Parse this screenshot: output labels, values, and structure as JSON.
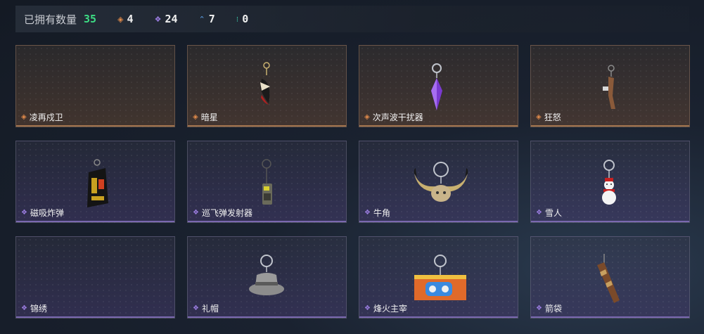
{
  "header": {
    "title": "已拥有数量",
    "total": "35",
    "stats": [
      {
        "name": "orange",
        "value": "4"
      },
      {
        "name": "purple",
        "value": "24"
      },
      {
        "name": "blue",
        "value": "7"
      },
      {
        "name": "teal",
        "value": "0"
      }
    ]
  },
  "items": [
    {
      "name": "凌再戍卫",
      "rarity": "orange"
    },
    {
      "name": "暗星",
      "rarity": "orange"
    },
    {
      "name": "次声波干扰器",
      "rarity": "orange"
    },
    {
      "name": "狂怒",
      "rarity": "orange"
    },
    {
      "name": "磁吸炸弹",
      "rarity": "purple"
    },
    {
      "name": "巡飞弹发射器",
      "rarity": "purple"
    },
    {
      "name": "牛角",
      "rarity": "purple"
    },
    {
      "name": "雪人",
      "rarity": "purple"
    },
    {
      "name": "锦绣",
      "rarity": "purple"
    },
    {
      "name": "礼帽",
      "rarity": "purple"
    },
    {
      "name": "烽火主宰",
      "rarity": "purple"
    },
    {
      "name": "箭袋",
      "rarity": "purple"
    }
  ],
  "colors": {
    "orange": "#e08a4a",
    "purple": "#9a7ce0",
    "blue": "#5aa0e6",
    "teal": "#3ed0b0",
    "total": "#3ddc84"
  }
}
